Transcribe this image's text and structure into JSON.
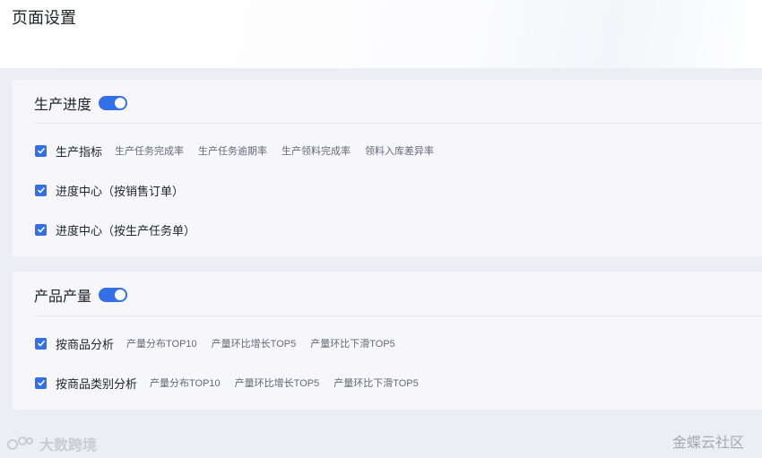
{
  "page": {
    "title": "页面设置"
  },
  "sections": [
    {
      "title": "生产进度",
      "toggle_on": true,
      "rows": [
        {
          "label": "生产指标",
          "checked": true,
          "subs": [
            "生产任务完成率",
            "生产任务逾期率",
            "生产领料完成率",
            "领料入库差异率"
          ]
        },
        {
          "label": "进度中心（按销售订单）",
          "checked": true,
          "subs": []
        },
        {
          "label": "进度中心（按生产任务单）",
          "checked": true,
          "subs": []
        }
      ]
    },
    {
      "title": "产品产量",
      "toggle_on": true,
      "rows": [
        {
          "label": "按商品分析",
          "checked": true,
          "subs": [
            "产量分布TOP10",
            "产量环比增长TOP5",
            "产量环比下滑TOP5"
          ]
        },
        {
          "label": "按商品类别分析",
          "checked": true,
          "subs": [
            "产量分布TOP10",
            "产量环比增长TOP5",
            "产量环比下滑TOP5"
          ]
        }
      ]
    }
  ],
  "watermarks": {
    "left": "大数跨境",
    "right": "金蝶云社区"
  },
  "colors": {
    "accent": "#3370e8",
    "card_bg": "#f7f7fb",
    "page_bg": "#eceef3"
  },
  "icons": {
    "checkbox": "check-icon",
    "toggle": "toggle-switch"
  }
}
